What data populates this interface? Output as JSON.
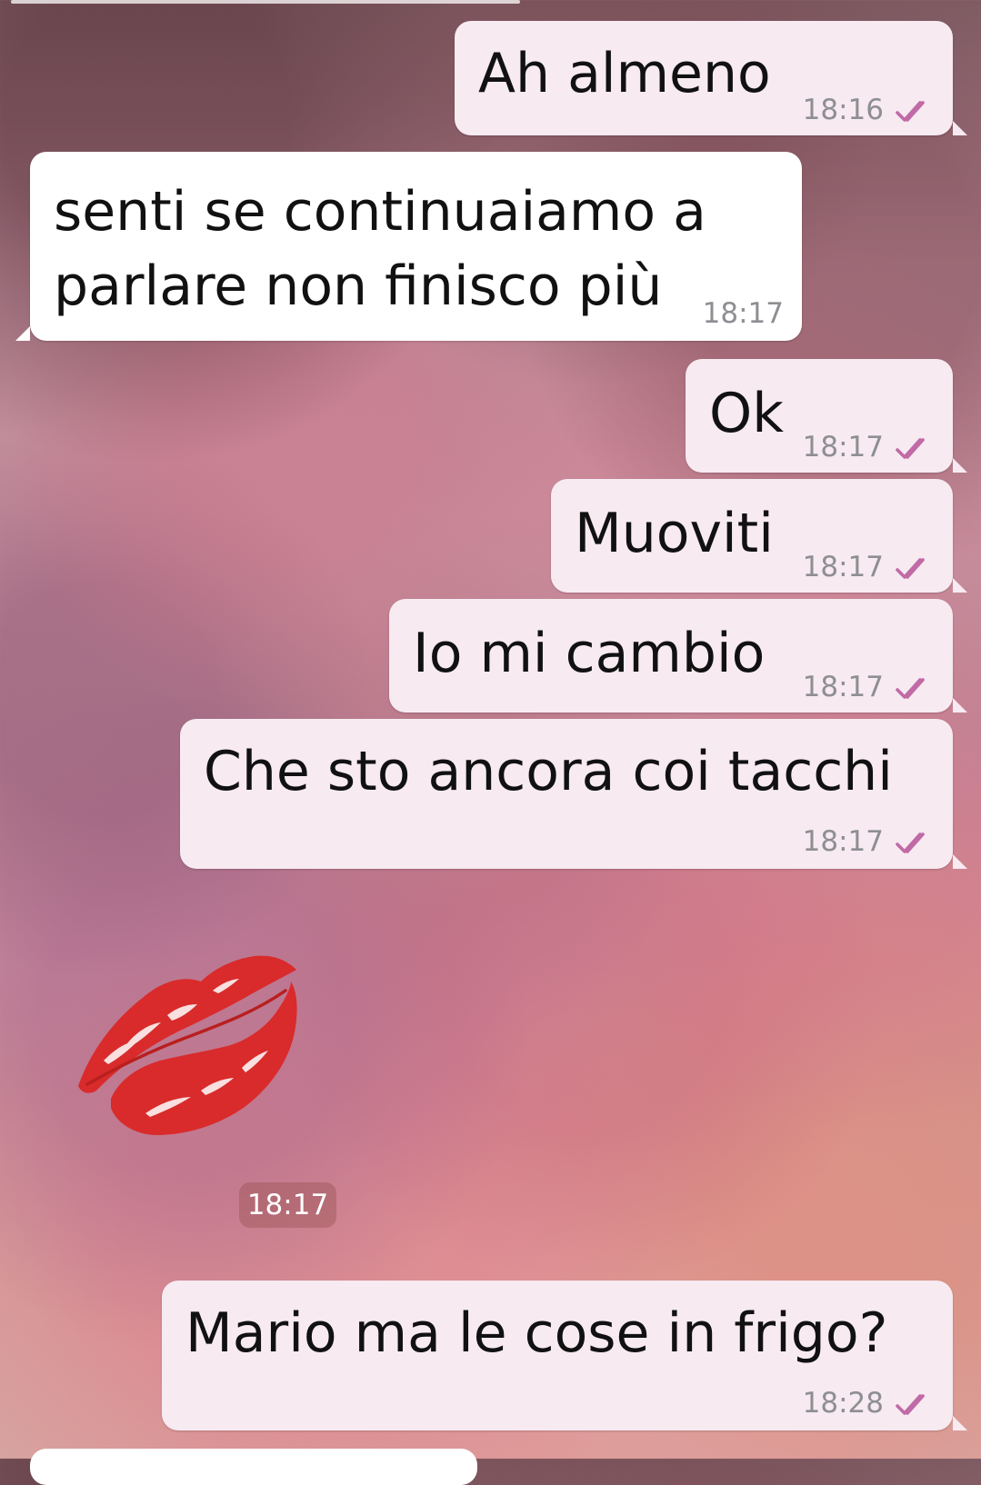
{
  "messages": [
    {
      "text": "Ah almeno",
      "time": "18:16",
      "direction": "outgoing",
      "read_status": "double-check-read"
    },
    {
      "text_lines": [
        "senti se continuaiamo a",
        "parlare non finisco più"
      ],
      "time": "18:17",
      "direction": "incoming"
    },
    {
      "text": "Ok",
      "time": "18:17",
      "direction": "outgoing",
      "read_status": "double-check-read"
    },
    {
      "text": "Muoviti",
      "time": "18:17",
      "direction": "outgoing",
      "read_status": "double-check-read"
    },
    {
      "text": "Io mi cambio",
      "time": "18:17",
      "direction": "outgoing",
      "read_status": "double-check-read"
    },
    {
      "text": "Che sto ancora coi tacchi",
      "time": "18:17",
      "direction": "outgoing",
      "read_status": "double-check-read"
    },
    {
      "type": "sticker",
      "sticker_icon": "kiss-mark-icon",
      "time": "18:17",
      "direction": "incoming"
    },
    {
      "text": "Mario ma le cose in frigo?",
      "time": "18:28",
      "direction": "outgoing",
      "read_status": "double-check-read"
    }
  ],
  "colors": {
    "outgoing_bubble": "#f7eaf1",
    "incoming_bubble": "#ffffff",
    "read_check": "#c06aa6",
    "time_text": "#8e8e93",
    "sticker_red": "#d92b2b"
  }
}
